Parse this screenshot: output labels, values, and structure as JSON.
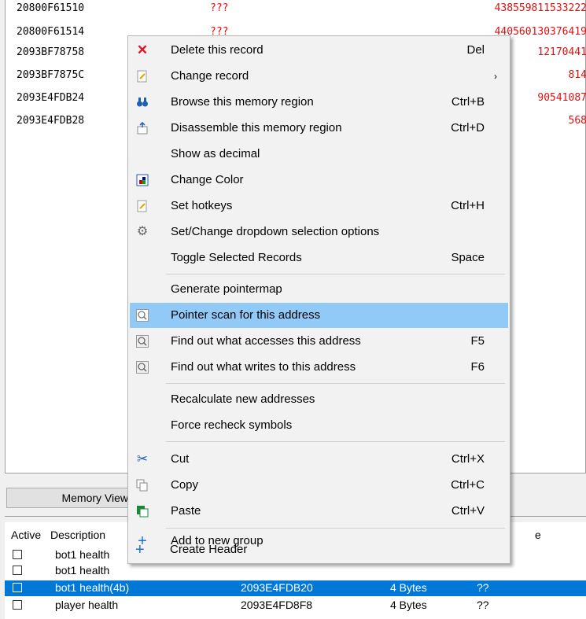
{
  "results": [
    {
      "address": "20800F61510",
      "value": "???",
      "previous": "438559811533222"
    },
    {
      "address": "20800F61514",
      "value": "???",
      "previous": "440560130376419"
    },
    {
      "address": "2093BF78758",
      "value": "",
      "previous": "12170441"
    },
    {
      "address": "2093BF7875C",
      "value": "",
      "previous": "814"
    },
    {
      "address": "2093E4FDB24",
      "value": "",
      "previous": "90541087"
    },
    {
      "address": "2093E4FDB28",
      "value": "",
      "previous": "568"
    }
  ],
  "memory_view_button": "Memory View",
  "table": {
    "headers": {
      "active": "Active",
      "description": "Description",
      "type": "e"
    },
    "rows": [
      {
        "description": "bot1 health",
        "address": "",
        "type": "",
        "value": "",
        "selected": false
      },
      {
        "description": "bot1 health",
        "address": "",
        "type": "",
        "value": "",
        "selected": false
      },
      {
        "description": "bot1 health(4b)",
        "address": "2093E4FDB20",
        "type": "4 Bytes",
        "value": "??",
        "selected": true
      },
      {
        "description": "player health",
        "address": "2093E4FD8F8",
        "type": "4 Bytes",
        "value": "??",
        "selected": false
      }
    ]
  },
  "context_menu": {
    "items": [
      {
        "icon": "delete-x-icon",
        "label": "Delete this record",
        "shortcut": "Del"
      },
      {
        "icon": "change-record-icon",
        "label": "Change record",
        "shortcut": "",
        "submenu": true
      },
      {
        "icon": "binoculars-icon",
        "label": "Browse this memory region",
        "shortcut": "Ctrl+B"
      },
      {
        "icon": "disassemble-icon",
        "label": "Disassemble this memory region",
        "shortcut": "Ctrl+D"
      },
      {
        "icon": "",
        "label": "Show as decimal",
        "shortcut": ""
      },
      {
        "icon": "color-palette-icon",
        "label": "Change Color",
        "shortcut": ""
      },
      {
        "icon": "hotkeys-icon",
        "label": "Set hotkeys",
        "shortcut": "Ctrl+H"
      },
      {
        "icon": "gear-icon",
        "label": "Set/Change dropdown selection options",
        "shortcut": ""
      },
      {
        "icon": "",
        "label": "Toggle Selected Records",
        "shortcut": "Space"
      },
      {
        "icon": "",
        "label": "Generate pointermap",
        "shortcut": ""
      },
      {
        "icon": "magnifier-icon",
        "label": "Pointer scan for this address",
        "shortcut": "",
        "highlighted": true
      },
      {
        "icon": "find-access-icon",
        "label": "Find out what accesses this address",
        "shortcut": "F5"
      },
      {
        "icon": "find-write-icon",
        "label": "Find out what writes to this address",
        "shortcut": "F6"
      },
      {
        "icon": "",
        "label": "Recalculate new addresses",
        "shortcut": ""
      },
      {
        "icon": "",
        "label": "Force recheck symbols",
        "shortcut": ""
      },
      {
        "icon": "scissors-icon",
        "label": "Cut",
        "shortcut": "Ctrl+X"
      },
      {
        "icon": "copy-icon",
        "label": "Copy",
        "shortcut": "Ctrl+C"
      },
      {
        "icon": "paste-icon",
        "label": "Paste",
        "shortcut": "Ctrl+V"
      },
      {
        "icon": "plus-icon",
        "label": "Add to new group",
        "shortcut": ""
      },
      {
        "icon": "plus-icon",
        "label": "Create Header",
        "shortcut": ""
      }
    ],
    "submenu_arrow": "›"
  },
  "colors": {
    "highlight": "#91c9f7",
    "selection": "#0078d7",
    "value_red": "#e01010"
  }
}
